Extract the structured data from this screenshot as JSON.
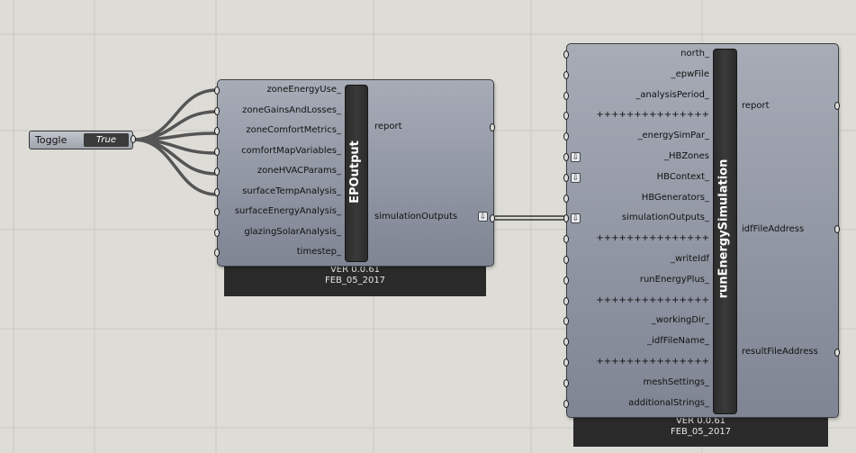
{
  "toggle": {
    "label": "Toggle",
    "value": "True"
  },
  "ep_output": {
    "name": "EPOutput",
    "inputs": [
      "zoneEnergyUse_",
      "zoneGainsAndLosses_",
      "zoneComfortMetrics_",
      "comfortMapVariables_",
      "zoneHVACParams_",
      "surfaceTempAnalysis_",
      "surfaceEnergyAnalysis_",
      "glazingSolarAnalysis_",
      "timestep_"
    ],
    "outputs": [
      "report",
      "simulationOutputs"
    ],
    "version": "VER 0.0.61",
    "date": "FEB_05_2017"
  },
  "run_energy_simulation": {
    "name": "runEnergySimulation",
    "inputs": [
      "north_",
      "_epwFile",
      "_analysisPeriod_",
      "+++++++++++++++",
      "_energySimPar_",
      "_HBZones",
      "HBContext_",
      "HBGenerators_",
      "simulationOutputs_",
      "+++++++++++++++",
      "_writeIdf",
      "runEnergyPlus_",
      "+++++++++++++++",
      "_workingDir_",
      "_idfFileName_",
      "+++++++++++++++",
      "meshSettings_",
      "additionalStrings_"
    ],
    "outputs": [
      "report",
      "idfFileAddress",
      "resultFileAddress"
    ],
    "version": "VER 0.0.61",
    "date": "FEB_05_2017"
  }
}
